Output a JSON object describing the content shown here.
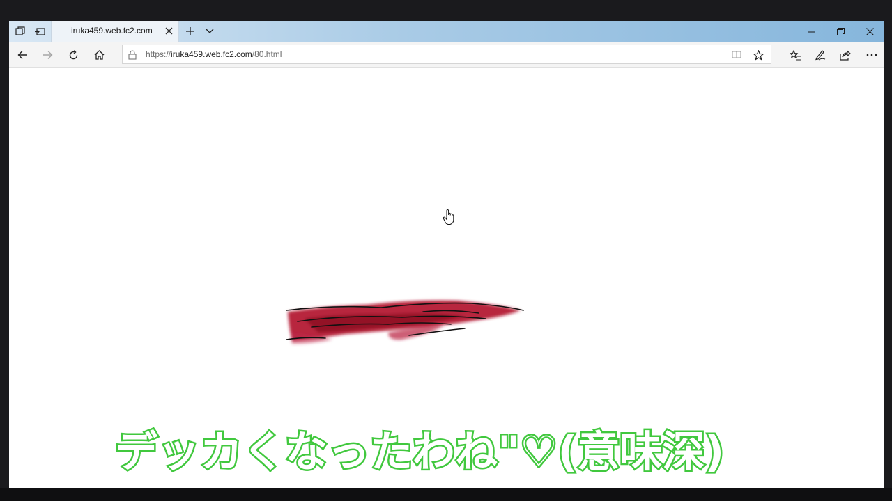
{
  "browser": {
    "tab": {
      "title": "iruka459.web.fc2.com"
    },
    "address": {
      "prefix": "https://",
      "host": "iruka459.web.fc2.com",
      "path": "/80.html"
    }
  },
  "icons": {
    "tab_set_aside": "tabs-aside-icon",
    "tab_preview": "tab-preview-icon",
    "tab_close": "close-icon",
    "new_tab": "plus-icon",
    "tab_list": "chevron-down-icon",
    "minimize": "minimize-icon",
    "restore": "restore-icon",
    "close_window": "close-icon",
    "back": "arrow-left-icon",
    "forward": "arrow-right-icon",
    "refresh": "refresh-icon",
    "home": "home-icon",
    "lock": "lock-icon",
    "reading_view": "book-icon",
    "favorite": "star-icon",
    "favorites_hub": "favorites-list-icon",
    "notes": "pen-icon",
    "share": "share-icon",
    "more": "ellipsis-icon"
  },
  "caption": {
    "text": "デッカくなったわね\"♡(意味深)"
  },
  "colors": {
    "caption_stroke": "#41c83e",
    "caption_fill": "#ffffff",
    "blob_red": "#b0102a",
    "titlebar": "#a9cbe6"
  }
}
